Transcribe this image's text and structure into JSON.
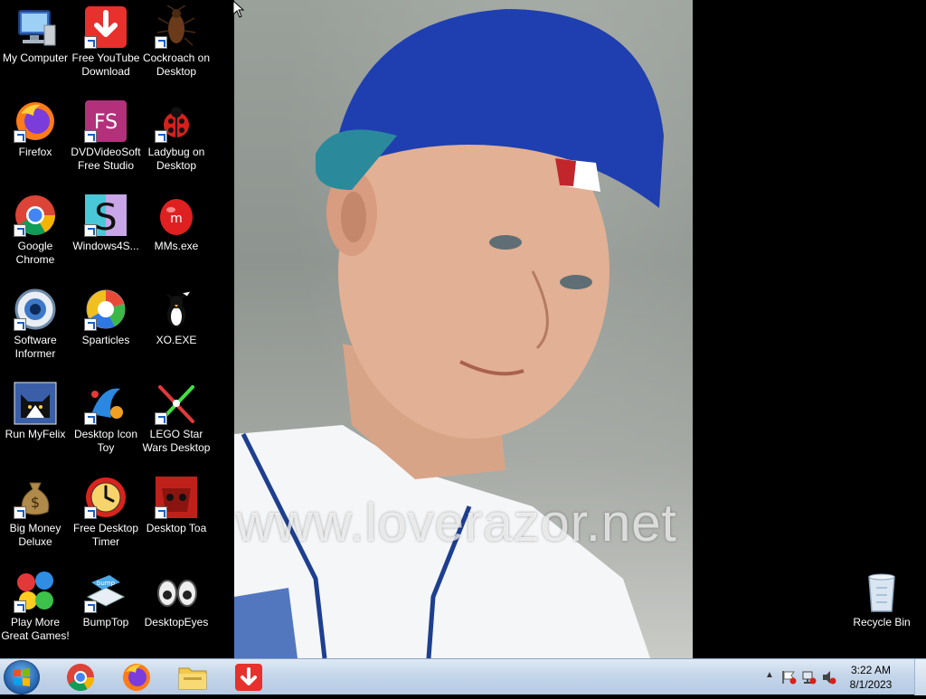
{
  "desktop": {
    "icons": [
      {
        "label": "My Computer",
        "icon": "computer-icon"
      },
      {
        "label": "Free YouTube Download",
        "icon": "download-arrow-icon"
      },
      {
        "label": "Cockroach on Desktop",
        "icon": "cockroach-icon"
      },
      {
        "label": "Firefox",
        "icon": "firefox-icon"
      },
      {
        "label": "DVDVideoSoft Free Studio",
        "icon": "fs-icon"
      },
      {
        "label": "Ladybug on Desktop",
        "icon": "ladybug-icon"
      },
      {
        "label": "Google Chrome",
        "icon": "chrome-icon"
      },
      {
        "label": "Windows4S...",
        "icon": "s-letter-icon"
      },
      {
        "label": "MMs.exe",
        "icon": "mms-candy-icon"
      },
      {
        "label": "Software Informer",
        "icon": "eye-lens-icon"
      },
      {
        "label": "Sparticles",
        "icon": "sparticles-icon"
      },
      {
        "label": "XO.EXE",
        "icon": "penguin-icon"
      },
      {
        "label": "Run MyFelix",
        "icon": "cat-icon"
      },
      {
        "label": "Desktop Icon Toy",
        "icon": "icon-toy-icon"
      },
      {
        "label": "LEGO Star Wars Desktop",
        "icon": "lightsaber-icon"
      },
      {
        "label": "Big Money Deluxe",
        "icon": "money-bag-icon"
      },
      {
        "label": "Free Desktop Timer",
        "icon": "clock-icon"
      },
      {
        "label": "Desktop Toa",
        "icon": "red-mask-icon"
      },
      {
        "label": "Play More Great Games!",
        "icon": "games-icon"
      },
      {
        "label": "BumpTop",
        "icon": "bumptop-icon"
      },
      {
        "label": "DesktopEyes",
        "icon": "eyes-icon"
      },
      {
        "label": "Recycle Bin",
        "icon": "recycle-bin-icon"
      }
    ],
    "wallpaper_watermark": "www.loverazor.net"
  },
  "taskbar": {
    "pinned": [
      {
        "name": "chrome",
        "icon": "chrome-icon"
      },
      {
        "name": "firefox",
        "icon": "firefox-icon"
      },
      {
        "name": "explorer",
        "icon": "folder-icon"
      },
      {
        "name": "free-youtube-download",
        "icon": "download-arrow-icon"
      }
    ],
    "clock": {
      "time": "3:22 AM",
      "date": "8/1/2023"
    }
  },
  "colors": {
    "taskbar": "#c5d6ea",
    "desktop_bg": "#000000"
  }
}
